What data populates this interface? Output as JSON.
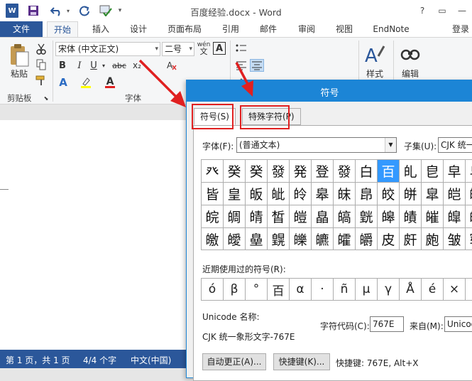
{
  "titlebar": {
    "doc_title": "百度经验.docx - Word",
    "help": "?",
    "restore": "▭",
    "minimize": "—"
  },
  "tabs": {
    "file": "文件",
    "home": "开始",
    "insert": "插入",
    "design": "设计",
    "layout": "页面布局",
    "references": "引用",
    "mailings": "邮件",
    "review": "审阅",
    "view": "视图",
    "endnote": "EndNote",
    "login": "登录"
  },
  "ribbon": {
    "paste_label": "粘贴",
    "clipboard_group": "剪贴板",
    "font_name": "宋体 (中文正文)",
    "font_size": "二号",
    "wen": "wén",
    "bold": "B",
    "italic": "I",
    "underline": "U",
    "strike": "abc",
    "sub": "x₂",
    "font_group": "字体",
    "styles_label": "样式",
    "editing_label": "编辑"
  },
  "statusbar": {
    "page": "第 1 页，共 1 页",
    "words": "4/4 个字",
    "lang": "中文(中国)"
  },
  "dialog": {
    "title": "符号",
    "tab_symbols": "符号(S)",
    "tab_special": "特殊字符(P)",
    "font_label": "字体(F):",
    "font_value": "(普通文本)",
    "subset_label": "子集(U):",
    "subset_value": "CJK 统一",
    "symbols": [
      "癶",
      "癸",
      "癸",
      "發",
      "発",
      "登",
      "發",
      "白",
      "百",
      "癿",
      "皀",
      "皁",
      "皂",
      "皆",
      "皇",
      "皈",
      "皉",
      "皊",
      "皋",
      "皌",
      "皍",
      "皎",
      "皏",
      "皐",
      "皑",
      "皒",
      "皖",
      "皗",
      "皘",
      "皙",
      "皚",
      "皛",
      "皜",
      "皝",
      "皞",
      "皟",
      "皠",
      "皡",
      "皢",
      "皦",
      "皧",
      "皨",
      "皩",
      "皪",
      "皫",
      "皬",
      "皭",
      "皮",
      "皯",
      "皰",
      "皱",
      "皲"
    ],
    "selected_index": 8,
    "recent_label": "近期使用过的符号(R):",
    "recent": [
      "ó",
      "β",
      "°",
      "百",
      "α",
      "·",
      "ñ",
      "μ",
      "γ",
      "Å",
      "é",
      "×",
      "º"
    ],
    "unicode_name_label": "Unicode 名称:",
    "unicode_name_value": "CJK 统一象形文字-767E",
    "char_code_label": "字符代码(C):",
    "char_code_value": "767E",
    "from_label": "来自(M):",
    "from_value": "Unicode",
    "autocorrect_button": "自动更正(A)...",
    "shortcut_button": "快捷键(K)...",
    "shortcut_text": "快捷键: 767E, Alt+X"
  }
}
